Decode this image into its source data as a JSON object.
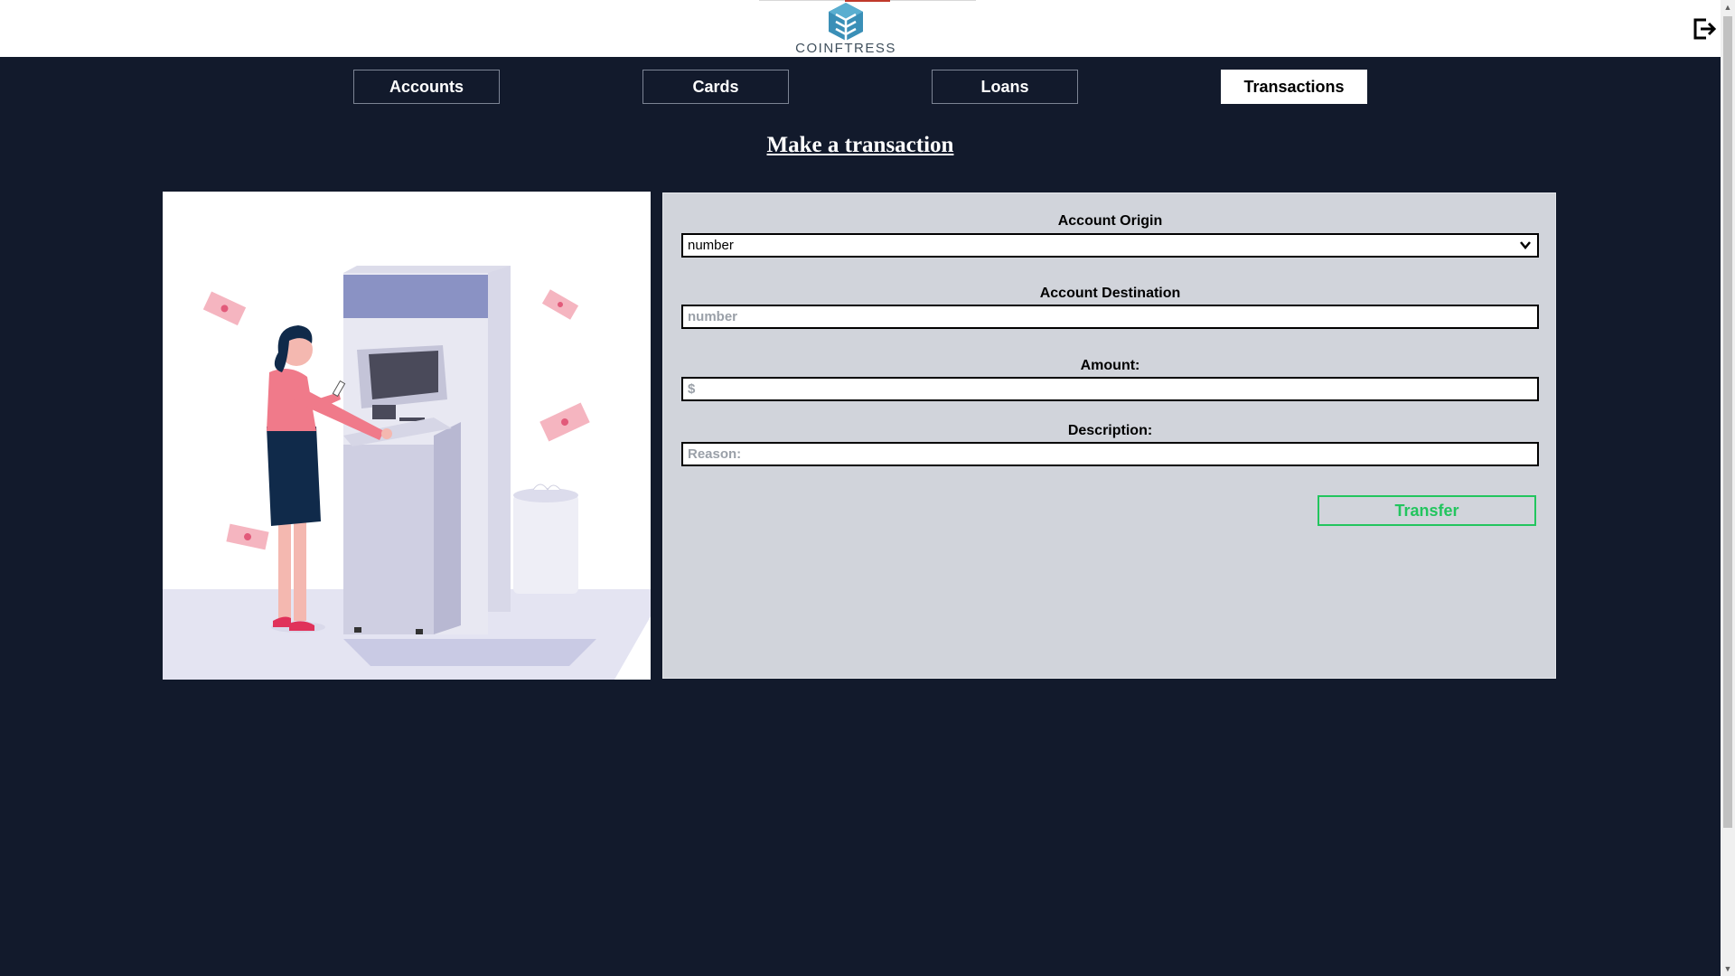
{
  "brand": {
    "name": "COINFTRESS",
    "accent": "#3a8fb7"
  },
  "header": {
    "logout_icon": "logout-icon"
  },
  "nav": {
    "tabs": [
      {
        "label": "Accounts",
        "active": false
      },
      {
        "label": "Cards",
        "active": false
      },
      {
        "label": "Loans",
        "active": false
      },
      {
        "label": "Transactions",
        "active": true
      }
    ]
  },
  "main": {
    "title": "Make a transaction",
    "illustration": "woman-using-atm-illustration"
  },
  "form": {
    "origin": {
      "label": "Account Origin",
      "value": "number"
    },
    "destination": {
      "label": "Account Destination",
      "placeholder": "number"
    },
    "amount": {
      "label": "Amount:",
      "placeholder": "$"
    },
    "description": {
      "label": "Description:",
      "placeholder": "Reason:"
    },
    "submit_label": "Transfer",
    "submit_color": "#22c55e"
  },
  "colors": {
    "background": "#121a2c",
    "panel": "#d1d4db"
  }
}
